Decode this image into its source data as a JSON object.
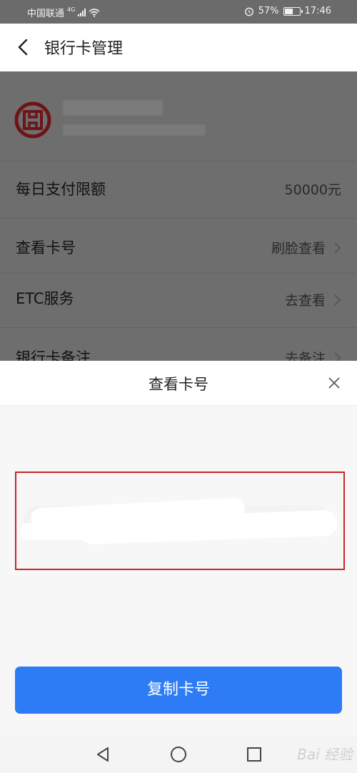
{
  "status_bar": {
    "carrier": "中国联通",
    "network": "4G",
    "battery": "57%",
    "time": "17:46"
  },
  "header": {
    "back_icon": "chevron-left-icon",
    "title": "银行卡管理"
  },
  "bank_card": {
    "logo_icon": "icbc-logo-icon"
  },
  "rows": [
    {
      "label": "每日支付限额",
      "value": "50000元"
    },
    {
      "label": "查看卡号",
      "value": "刷脸查看"
    },
    {
      "label": "ETC服务",
      "value": "去查看"
    },
    {
      "label": "银行卡备注",
      "value": "去备注"
    }
  ],
  "sheet": {
    "title": "查看卡号",
    "close_icon": "close-icon",
    "highlight_color": "#c9242b",
    "copy_button": "复制卡号",
    "button_color": "#2d7cf6"
  },
  "nav": {
    "back_icon": "triangle-back-icon",
    "home_icon": "circle-home-icon",
    "recents_icon": "square-recents-icon",
    "watermark": "Bai 经验"
  }
}
